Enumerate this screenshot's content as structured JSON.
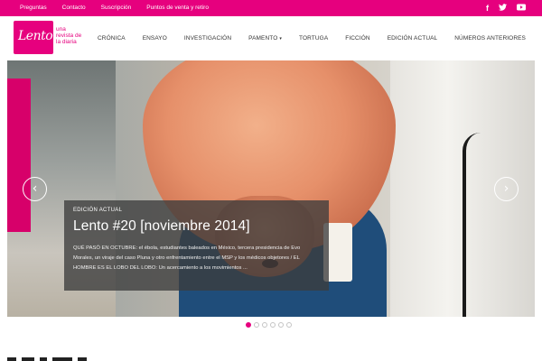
{
  "topbar": {
    "links": [
      "Preguntas",
      "Contacto",
      "Suscripción",
      "Puntos de venta y retiro"
    ],
    "social": {
      "facebook": "f",
      "twitter": "t",
      "youtube": "▶"
    },
    "color": "#e6007e"
  },
  "header": {
    "logo_text": "Lento",
    "tagline": "una revista de la diaria",
    "nav": [
      "CRÓNICA",
      "ENSAYO",
      "INVESTIGACIÓN",
      "PAMENTO",
      "TORTUGA",
      "FICCIÓN",
      "EDICIÓN ACTUAL",
      "NÚMEROS ANTERIORES"
    ],
    "nav_dropdown_caret": "▾"
  },
  "hero": {
    "kicker": "EDICIÓN ACTUAL",
    "title": "Lento #20 [noviembre 2014]",
    "description": "QUÉ PASÓ EN OCTUBRE: el ébola, estudiantes baleados en México, tercera presidencia de Evo Morales, un viraje del caso Pluna y otro enfrentamiento entre el MSP y los médicos objetores / EL HOMBRE ES EL LOBO DEL LOBO: Un acercamiento a los movimientos ...",
    "prev_arrow": "‹",
    "next_arrow": "›"
  },
  "slider": {
    "total_slides": 6,
    "active_index": 0
  }
}
